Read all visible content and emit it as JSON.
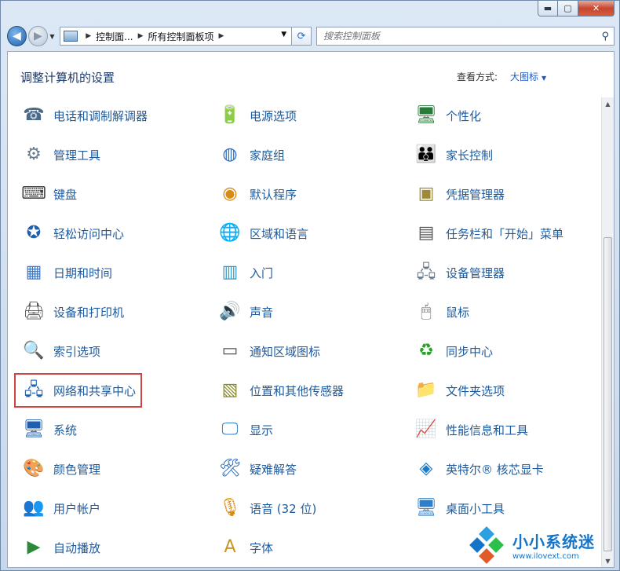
{
  "window": {
    "caption": {
      "minimize": "▬",
      "maximize": "▢",
      "close": "✕"
    }
  },
  "addressbar": {
    "back_icon": "◀",
    "forward_icon": "▶",
    "crumbs": [
      "控制面...",
      "所有控制面板项"
    ],
    "refresh_icon": "⟳",
    "search_placeholder": "搜索控制面板"
  },
  "header": {
    "title": "调整计算机的设置",
    "view_label": "查看方式:",
    "view_value": "大图标"
  },
  "items": [
    {
      "label": "电话和调制解调器",
      "icon": "phone-modem-icon",
      "glyph": "☎",
      "color": "#4b6a88"
    },
    {
      "label": "电源选项",
      "icon": "power-options-icon",
      "glyph": "🔋",
      "color": "#3a8a2a"
    },
    {
      "label": "个性化",
      "icon": "personalization-icon",
      "glyph": "🖥",
      "color": "#2a7a3a"
    },
    {
      "label": "管理工具",
      "icon": "admin-tools-icon",
      "glyph": "⚙",
      "color": "#6b7b8c"
    },
    {
      "label": "家庭组",
      "icon": "homegroup-icon",
      "glyph": "◍",
      "color": "#2f6fc0"
    },
    {
      "label": "家长控制",
      "icon": "parental-controls-icon",
      "glyph": "👪",
      "color": "#3a7acb"
    },
    {
      "label": "键盘",
      "icon": "keyboard-icon",
      "glyph": "⌨",
      "color": "#444"
    },
    {
      "label": "默认程序",
      "icon": "default-programs-icon",
      "glyph": "◉",
      "color": "#d88a12"
    },
    {
      "label": "凭据管理器",
      "icon": "credential-manager-icon",
      "glyph": "▣",
      "color": "#9c8a3a"
    },
    {
      "label": "轻松访问中心",
      "icon": "ease-of-access-icon",
      "glyph": "✪",
      "color": "#1f5fb0"
    },
    {
      "label": "区域和语言",
      "icon": "region-language-icon",
      "glyph": "🌐",
      "color": "#2f7fc8"
    },
    {
      "label": "任务栏和「开始」菜单",
      "icon": "taskbar-start-icon",
      "glyph": "▤",
      "color": "#555"
    },
    {
      "label": "日期和时间",
      "icon": "date-time-icon",
      "glyph": "▦",
      "color": "#3a7acb"
    },
    {
      "label": "入门",
      "icon": "getting-started-icon",
      "glyph": "▥",
      "color": "#2f9ac8"
    },
    {
      "label": "设备管理器",
      "icon": "device-manager-icon",
      "glyph": "🖧",
      "color": "#6b7b8c"
    },
    {
      "label": "设备和打印机",
      "icon": "devices-printers-icon",
      "glyph": "🖨",
      "color": "#555"
    },
    {
      "label": "声音",
      "icon": "sound-icon",
      "glyph": "🔊",
      "color": "#777"
    },
    {
      "label": "鼠标",
      "icon": "mouse-icon",
      "glyph": "🖱",
      "color": "#666"
    },
    {
      "label": "索引选项",
      "icon": "indexing-options-icon",
      "glyph": "🔍",
      "color": "#3a7acb"
    },
    {
      "label": "通知区域图标",
      "icon": "notification-icons-icon",
      "glyph": "▭",
      "color": "#555"
    },
    {
      "label": "同步中心",
      "icon": "sync-center-icon",
      "glyph": "♻",
      "color": "#2aa02a"
    },
    {
      "label": "网络和共享中心",
      "icon": "network-sharing-icon",
      "glyph": "🖧",
      "color": "#1f5fb0",
      "highlight": true
    },
    {
      "label": "位置和其他传感器",
      "icon": "location-sensors-icon",
      "glyph": "▧",
      "color": "#8a8a2a"
    },
    {
      "label": "文件夹选项",
      "icon": "folder-options-icon",
      "glyph": "📁",
      "color": "#d8a82a"
    },
    {
      "label": "系统",
      "icon": "system-icon",
      "glyph": "🖥",
      "color": "#1f5fb0"
    },
    {
      "label": "显示",
      "icon": "display-icon",
      "glyph": "🖵",
      "color": "#2f7fc8"
    },
    {
      "label": "性能信息和工具",
      "icon": "performance-icon",
      "glyph": "📈",
      "color": "#2a7a3a"
    },
    {
      "label": "颜色管理",
      "icon": "color-management-icon",
      "glyph": "🎨",
      "color": "#c84a2a"
    },
    {
      "label": "疑难解答",
      "icon": "troubleshooting-icon",
      "glyph": "🛠",
      "color": "#1f5fb0"
    },
    {
      "label": "英特尔® 核芯显卡",
      "icon": "intel-graphics-icon",
      "glyph": "◈",
      "color": "#1a7ac8"
    },
    {
      "label": "用户帐户",
      "icon": "user-accounts-icon",
      "glyph": "👥",
      "color": "#3a8a2a"
    },
    {
      "label": "语音 (32 位)",
      "icon": "speech-icon",
      "glyph": "🎙",
      "color": "#d88a12"
    },
    {
      "label": "桌面小工具",
      "icon": "desktop-gadgets-icon",
      "glyph": "🖥",
      "color": "#2f7fc8"
    },
    {
      "label": "自动播放",
      "icon": "autoplay-icon",
      "glyph": "▶",
      "color": "#2a8a3a"
    },
    {
      "label": "字体",
      "icon": "fonts-icon",
      "glyph": "A",
      "color": "#c8962a"
    }
  ],
  "watermark": {
    "name": "小小系统迷",
    "url": "www.ilovext.com",
    "colors": [
      "#2aa0e0",
      "#1474c8",
      "#2ac04a",
      "#e05a2a"
    ]
  }
}
